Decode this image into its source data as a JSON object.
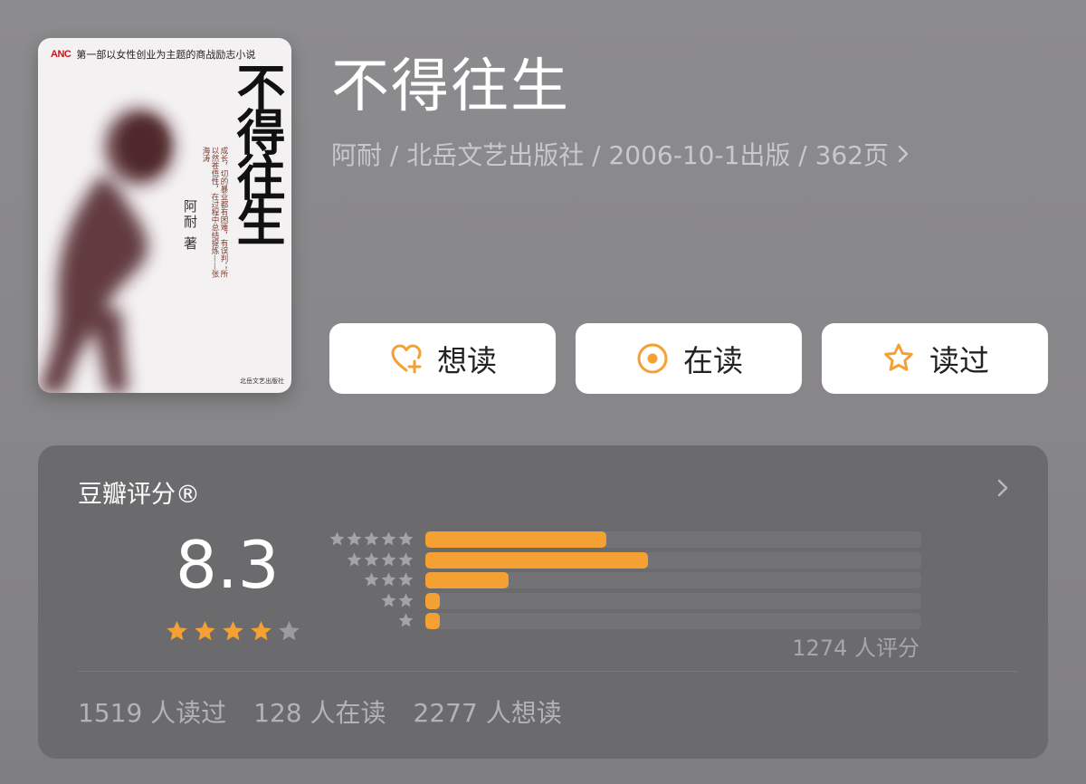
{
  "cover": {
    "series_logo": "ANC",
    "tagline": "第一部以女性创业为主题的商战励志小说",
    "title": "不得往生",
    "quote": "成长，切的暴业都有困难，有误判；所以然苍悟性，在过程中总结提炼——张海涛",
    "author": "阿耐 著",
    "publisher": "北岳文艺出版社"
  },
  "book": {
    "title": "不得往生",
    "meta": "阿耐 / 北岳文艺出版社 / 2006-10-1出版 / 362页"
  },
  "actions": [
    {
      "label": "想读",
      "icon": "heart-plus-icon"
    },
    {
      "label": "在读",
      "icon": "target-circle-icon"
    },
    {
      "label": "读过",
      "icon": "star-outline-icon"
    }
  ],
  "rating": {
    "header": "豆瓣评分®",
    "score": "8.3",
    "stars_filled": 4,
    "stars_total": 5,
    "count_text": "1274 人评分",
    "distribution": [
      {
        "stars": 5,
        "fraction": 0.365
      },
      {
        "stars": 4,
        "fraction": 0.448
      },
      {
        "stars": 3,
        "fraction": 0.167
      },
      {
        "stars": 2,
        "fraction": 0.03
      },
      {
        "stars": 1,
        "fraction": 0.03
      }
    ]
  },
  "reader_stats": {
    "read": "1519 人读过",
    "reading": "128 人在读",
    "want": "2277 人想读"
  },
  "colors": {
    "accent_orange": "#f5a033",
    "background": "#878688",
    "panel": "#6b6a6c"
  }
}
